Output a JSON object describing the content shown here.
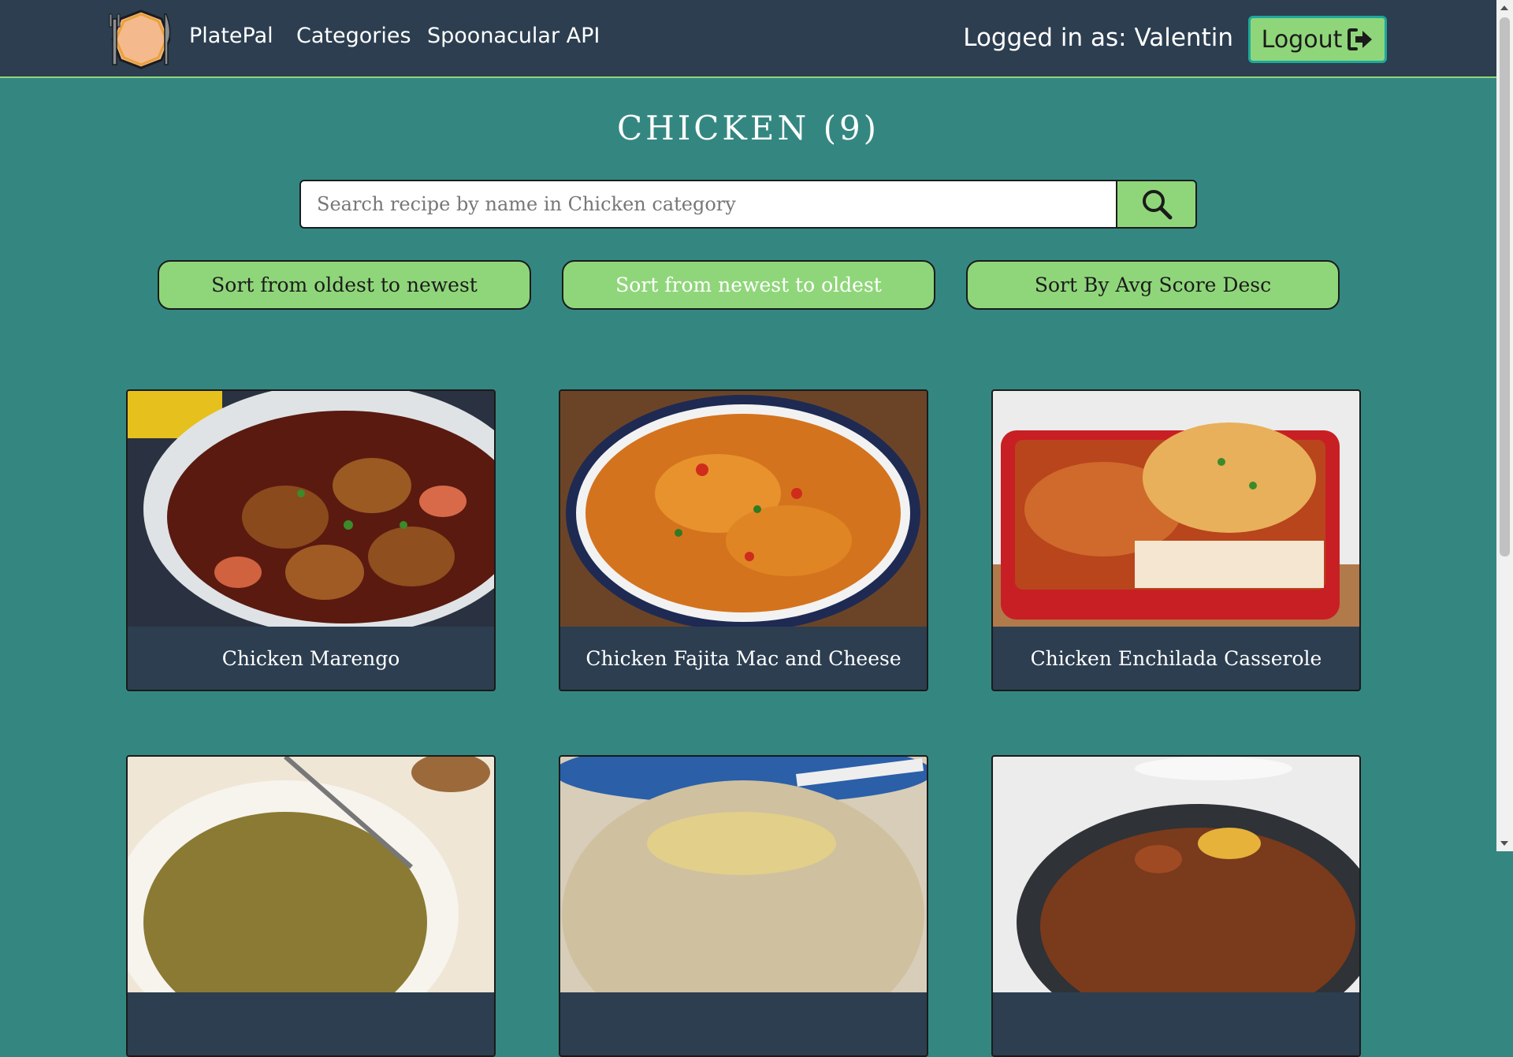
{
  "navbar": {
    "brand": "PlatePal",
    "categories_link": "Categories",
    "api_link": "Spoonacular API",
    "user_label": "Logged in as: Valentin",
    "logout_label": "Logout"
  },
  "page": {
    "title": "CHICKEN (9)"
  },
  "search": {
    "placeholder": "Search recipe by name in Chicken category"
  },
  "sort": {
    "oldest_label": "Sort from oldest to newest",
    "newest_label": "Sort from newest to oldest",
    "score_label": "Sort By Avg Score Desc"
  },
  "recipes": [
    {
      "title": "Chicken Marengo"
    },
    {
      "title": "Chicken Fajita Mac and Cheese"
    },
    {
      "title": "Chicken Enchilada Casserole"
    },
    {
      "title": ""
    },
    {
      "title": ""
    },
    {
      "title": ""
    }
  ],
  "colors": {
    "background": "#348781",
    "navbar": "#2c3e50",
    "accent_green": "#8fd67a"
  }
}
